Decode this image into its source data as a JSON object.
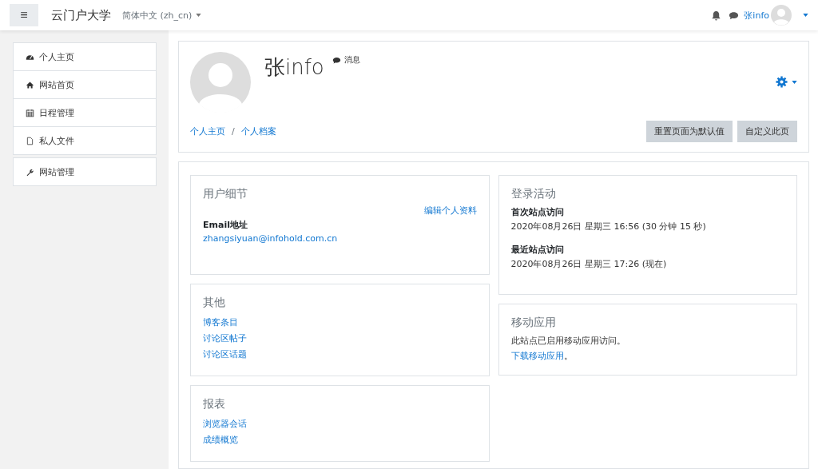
{
  "navbar": {
    "menu_icon": "≡",
    "site_name": "云门户大学",
    "language": "简体中文 (zh_cn)",
    "user_name": "张info"
  },
  "sidebar": {
    "groups": [
      [
        {
          "label": "个人主页"
        },
        {
          "label": "网站首页"
        },
        {
          "label": "日程管理"
        },
        {
          "label": "私人文件"
        }
      ],
      [
        {
          "label": "网站管理"
        }
      ]
    ]
  },
  "header": {
    "name": "张info",
    "message_label": "消息",
    "breadcrumb": [
      "个人主页",
      "个人档案"
    ],
    "breadcrumb_separator": "/",
    "buttons": [
      "重置页面为默认值",
      "自定义此页"
    ]
  },
  "left_cards": [
    {
      "title": "用户细节",
      "edit_link": "编辑个人资料",
      "fields": [
        {
          "label": "Email地址",
          "value": "zhangsiyuan@infohold.com.cn"
        }
      ]
    },
    {
      "title": "其他",
      "links": [
        "博客条目",
        "讨论区帖子",
        "讨论区话题"
      ]
    },
    {
      "title": "报表",
      "links": [
        "浏览器会话",
        "成绩概览"
      ]
    }
  ],
  "right_cards": [
    {
      "title": "登录活动",
      "entries": [
        {
          "label": "首次站点访问",
          "value": "2020年08月26日 星期三 16:56 (30 分钟 15 秒)"
        },
        {
          "label": "最近站点访问",
          "value": "2020年08月26日 星期三 17:26 (现在)"
        }
      ]
    },
    {
      "title": "移动应用",
      "text": "此站点已启用移动应用访问。",
      "link": "下载移动应用",
      "link_suffix": "。"
    }
  ]
}
